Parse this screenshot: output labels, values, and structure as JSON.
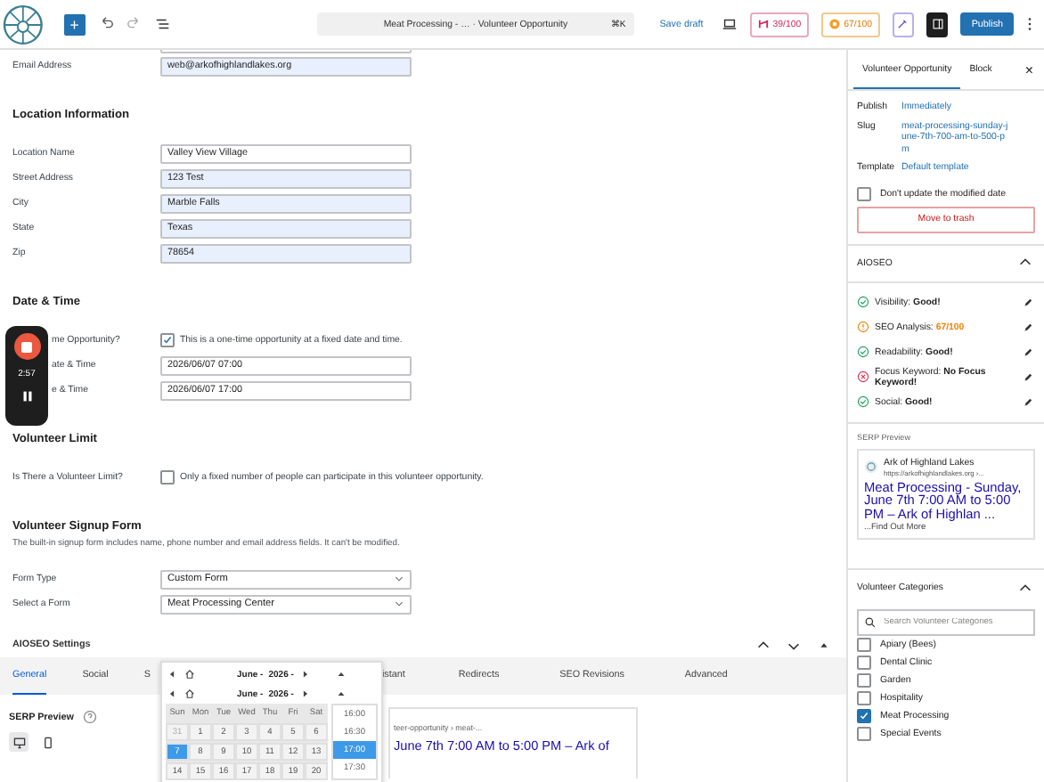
{
  "topbar": {
    "add": "+",
    "document_title": "Meat Processing - … · Volunteer Opportunity",
    "shortcut": "⌘K",
    "save_draft": "Save draft",
    "seo_score": "39/100",
    "readability_score": "67/100",
    "publish": "Publish"
  },
  "sections": [
    {
      "rows": [
        {
          "kind": "input",
          "label": "Email Address",
          "value": "web@arkofhighlandlakes.org",
          "filled": true
        }
      ]
    },
    {
      "heading": "Location Information",
      "rows": [
        {
          "kind": "input",
          "label": "Location Name",
          "value": "Valley View Village",
          "filled": false
        },
        {
          "kind": "input",
          "label": "Street Address",
          "value": "123 Test",
          "filled": true
        },
        {
          "kind": "input",
          "label": "City",
          "value": "Marble Falls",
          "filled": true
        },
        {
          "kind": "input",
          "label": "State",
          "value": "Texas",
          "filled": true
        },
        {
          "kind": "input",
          "label": "Zip",
          "value": "78654",
          "filled": true
        }
      ]
    },
    {
      "heading": "Date & Time",
      "rows": [
        {
          "kind": "checkbox",
          "label": "me Opportunity?",
          "text": "This is a one-time opportunity at a fixed date and time.",
          "checked": true
        },
        {
          "kind": "input",
          "label": "ate & Time",
          "value": "2026/06/07 07:00",
          "filled": false
        },
        {
          "kind": "input",
          "label": "e & Time",
          "value": "2026/06/07 17:00",
          "filled": false
        }
      ]
    },
    {
      "heading": "Volunteer Limit",
      "rows": [
        {
          "kind": "checkbox",
          "label": "Is There a Volunteer Limit?",
          "text": "Only a fixed number of people can participate in this volunteer opportunity.",
          "checked": false
        }
      ]
    },
    {
      "heading": "Volunteer Signup Form",
      "description": "The built-in signup form includes name, phone number and email address fields. It can't be modified.",
      "rows": [
        {
          "kind": "select",
          "label": "Form Type",
          "value": "Custom Form"
        },
        {
          "kind": "select",
          "label": "Select a Form",
          "value": "Meat Processing Center"
        }
      ]
    }
  ],
  "recorder": {
    "time": "2:57"
  },
  "aioseo": {
    "title": "AIOSEO Settings",
    "tabs": [
      {
        "label": "General",
        "selected": true
      },
      {
        "label": "Social",
        "selected": false
      },
      {
        "label": "S",
        "selected": false
      },
      {
        "label": "istant",
        "selected": false
      },
      {
        "label": "Redirects",
        "selected": false
      },
      {
        "label": "SEO Revisions",
        "selected": false
      },
      {
        "label": "Advanced",
        "selected": false
      }
    ],
    "serp_title": "SERP Preview",
    "serp_url": "teer-opportunity › meat-...",
    "serp_heading": "June 7th 7:00 AM to 5:00 PM – Ark of"
  },
  "calendar": {
    "headers": [
      {
        "month": "June -",
        "year": "2026 -"
      },
      {
        "month": "June -",
        "year": "2026 -"
      }
    ],
    "weekdays": [
      "Sun",
      "Mon",
      "Tue",
      "Wed",
      "Thu",
      "Fri",
      "Sat"
    ],
    "weeks": [
      [
        {
          "day": "31",
          "muted": true,
          "selected": false
        },
        {
          "day": "1",
          "muted": false,
          "selected": false
        },
        {
          "day": "2",
          "muted": false,
          "selected": false
        },
        {
          "day": "3",
          "muted": false,
          "selected": false
        },
        {
          "day": "4",
          "muted": false,
          "selected": false
        },
        {
          "day": "5",
          "muted": false,
          "selected": false
        },
        {
          "day": "6",
          "muted": false,
          "selected": false
        }
      ],
      [
        {
          "day": "7",
          "muted": false,
          "selected": true
        },
        {
          "day": "8",
          "muted": false,
          "selected": false
        },
        {
          "day": "9",
          "muted": false,
          "selected": false
        },
        {
          "day": "10",
          "muted": false,
          "selected": false
        },
        {
          "day": "11",
          "muted": false,
          "selected": false
        },
        {
          "day": "12",
          "muted": false,
          "selected": false
        },
        {
          "day": "13",
          "muted": false,
          "selected": false
        }
      ],
      [
        {
          "day": "14",
          "muted": false,
          "selected": false
        },
        {
          "day": "15",
          "muted": false,
          "selected": false
        },
        {
          "day": "16",
          "muted": false,
          "selected": false
        },
        {
          "day": "17",
          "muted": false,
          "selected": false
        },
        {
          "day": "18",
          "muted": false,
          "selected": false
        },
        {
          "day": "19",
          "muted": false,
          "selected": false
        },
        {
          "day": "20",
          "muted": false,
          "selected": false
        }
      ]
    ],
    "times": [
      {
        "label": "16:00",
        "selected": false
      },
      {
        "label": "16:30",
        "selected": false
      },
      {
        "label": "17:00",
        "selected": true
      },
      {
        "label": "17:30",
        "selected": false
      }
    ]
  },
  "sidebar": {
    "tabs": [
      {
        "label": "Volunteer Opportunity",
        "selected": true
      },
      {
        "label": "Block",
        "selected": false
      }
    ],
    "close": "×",
    "props": [
      {
        "label": "Publish",
        "value": "Immediately"
      },
      {
        "label": "Slug",
        "value": "meat-processing-sunday-june-7th-700-am-to-500-pm"
      },
      {
        "label": "Template",
        "value": "Default template"
      }
    ],
    "keep_date": {
      "label": "Don't update the modified date",
      "checked": false
    },
    "trash": "Move to trash",
    "aioseo_title": "AIOSEO",
    "checks": [
      {
        "label": "Visibility:",
        "value": "Good!",
        "kind": "good"
      },
      {
        "label": "SEO Analysis:",
        "value": "67/100",
        "kind": "warning"
      },
      {
        "label": "Readability:",
        "value": "Good!",
        "kind": "good"
      },
      {
        "label": "Focus Keyword:",
        "value": "No Focus Keyword!",
        "kind": "error"
      },
      {
        "label": "Social:",
        "value": "Good!",
        "kind": "good"
      }
    ],
    "serp_label": "SERP Preview",
    "serp_site": "Ark of Highland Lakes",
    "serp_url": "https://arkofhighlandlakes.org ›...",
    "serp_title": "Meat Processing - Sunday, June 7th 7:00 AM to 5:00 PM – Ark of Highlan ...",
    "serp_desc": "...Find Out More",
    "categories_title": "Volunteer Categories",
    "categories_search": {
      "placeholder": "Search Volunteer Categories"
    },
    "categories": [
      {
        "label": "Apiary (Bees)",
        "checked": false
      },
      {
        "label": "Dental Clinic",
        "checked": false
      },
      {
        "label": "Garden",
        "checked": false
      },
      {
        "label": "Hospitality",
        "checked": false
      },
      {
        "label": "Meat Processing",
        "checked": true
      },
      {
        "label": "Special Events",
        "checked": false
      }
    ]
  }
}
